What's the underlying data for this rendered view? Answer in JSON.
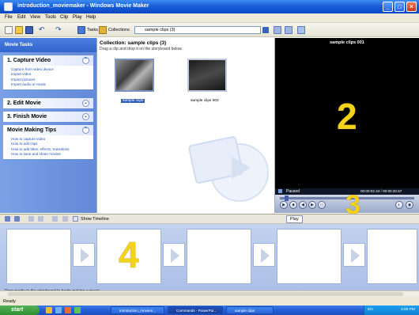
{
  "window": {
    "title": "introduction_moviemaker - Windows Movie Maker",
    "buttons": {
      "minimize": "_",
      "maximize": "□",
      "close": "×"
    }
  },
  "menu": [
    "File",
    "Edit",
    "View",
    "Tools",
    "Clip",
    "Play",
    "Help"
  ],
  "toolbar": {
    "tasks_label": "Tasks",
    "collections_label": "Collections",
    "collection_value": "sample clips (3)"
  },
  "task_pane": {
    "header": "Movie Tasks",
    "sections": [
      {
        "title": "1. Capture Video",
        "chevron": "⌃",
        "items": [
          "Capture from video device",
          "Import video",
          "Import pictures",
          "Import audio or music"
        ]
      },
      {
        "title": "2. Edit Movie",
        "chevron": "⌄",
        "items": []
      },
      {
        "title": "3. Finish Movie",
        "chevron": "⌄",
        "items": []
      },
      {
        "title": "Movie Making Tips",
        "chevron": "⌃",
        "items": [
          "How to capture video",
          "How to edit clips",
          "How to add titles, effects, transitions",
          "How to save and share movies"
        ]
      }
    ]
  },
  "collection": {
    "title": "Collection: sample clips (3)",
    "subtitle": "Drag a clip and drop it on the storyboard below.",
    "clips": [
      {
        "label": "sample clips"
      },
      {
        "label": "sample clips 002"
      }
    ]
  },
  "preview": {
    "title": "sample clips 001",
    "status": "Paused",
    "time": "00:00:02.34 / 00:00:20.57"
  },
  "storyboard": {
    "show_timeline": "Show Timeline",
    "play_label": "Play",
    "hint": "Drag media to the storyboard to begin making a movie."
  },
  "callouts": {
    "two": "2",
    "three": "3",
    "four": "4"
  },
  "status_bar": {
    "text": "Ready"
  },
  "taskbar": {
    "start": "start",
    "tasks": [
      "introduction_moviem...",
      "Commands - PowerPoi...",
      "sample clips"
    ],
    "tray_lang": "EN",
    "clock": "3:00 PM"
  },
  "colors": {
    "accent": "#1a5fd8",
    "callout": "#f2d21a",
    "task_pane": "#6f95dd"
  }
}
